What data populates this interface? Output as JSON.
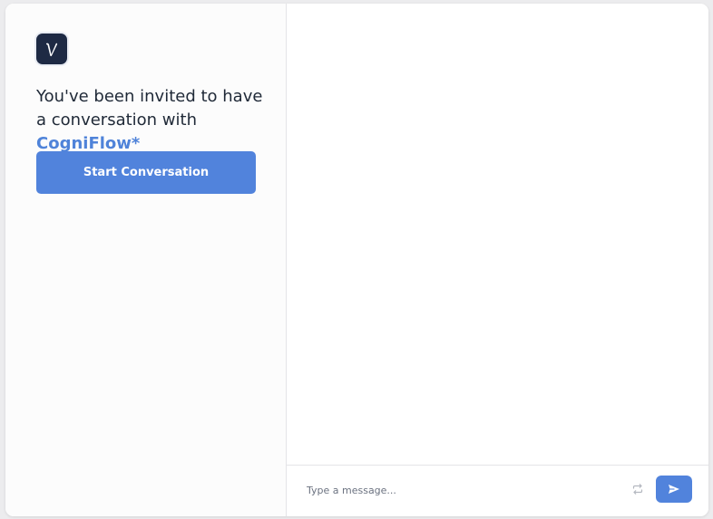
{
  "app": {
    "logo_letter": "v",
    "brand_color": "#1e2a44"
  },
  "invite": {
    "text_prefix": "You've been invited to have a conversation with ",
    "brand_name": "CogniFlow*",
    "brand_name_color": "#4f83d9"
  },
  "actions": {
    "start_label": "Start Conversation",
    "accent_color": "#5183dc"
  },
  "composer": {
    "placeholder": "Type a message...",
    "reset_icon": "refresh-icon",
    "send_icon": "send-icon"
  }
}
